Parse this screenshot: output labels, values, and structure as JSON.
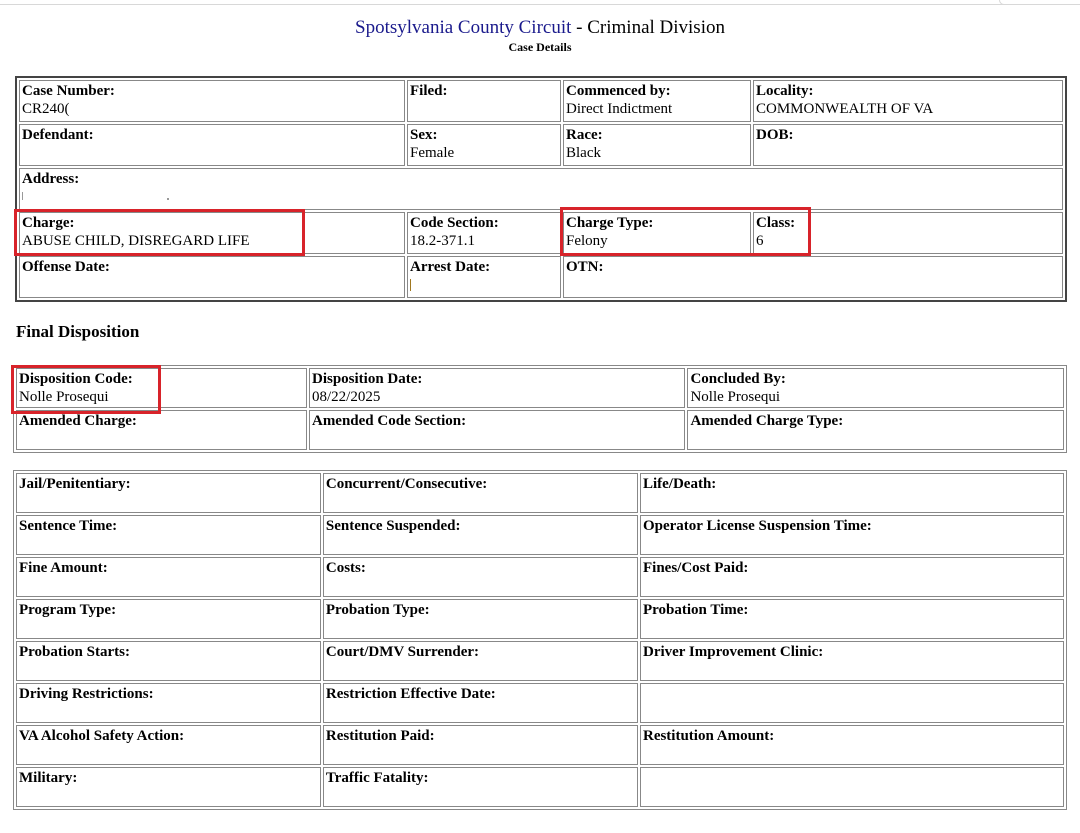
{
  "header": {
    "court_name": "Spotsylvania County Circuit",
    "division": " - Criminal Division",
    "subtitle": "Case Details"
  },
  "case": {
    "case_number_label": "Case Number:",
    "case_number": "CR240(",
    "filed_label": "Filed:",
    "filed": "",
    "commenced_label": "Commenced by:",
    "commenced": "Direct Indictment",
    "locality_label": "Locality:",
    "locality": "COMMONWEALTH OF VA",
    "defendant_label": "Defendant:",
    "defendant": "",
    "sex_label": "Sex:",
    "sex": "Female",
    "race_label": "Race:",
    "race": "Black",
    "dob_label": "DOB:",
    "dob": "",
    "address_label": "Address:",
    "charge_label": "Charge:",
    "charge": "ABUSE CHILD, DISREGARD LIFE",
    "code_section_label": "Code Section:",
    "code_section": "18.2-371.1",
    "charge_type_label": "Charge Type:",
    "charge_type": "Felony",
    "class_label": "Class:",
    "class": "6",
    "offense_date_label": "Offense Date:",
    "offense_date": "",
    "arrest_date_label": "Arrest Date:",
    "otn_label": "OTN:",
    "otn": ""
  },
  "final_disposition": {
    "title": "Final Disposition",
    "disposition_code_label": "Disposition Code:",
    "disposition_code": "Nolle Prosequi",
    "disposition_date_label": "Disposition Date:",
    "disposition_date": "08/22/2025",
    "concluded_by_label": "Concluded By:",
    "concluded_by": "Nolle Prosequi",
    "amended_charge_label": "Amended Charge:",
    "amended_code_section_label": "Amended Code Section:",
    "amended_charge_type_label": "Amended Charge Type:"
  },
  "sentencing": {
    "jail_label": "Jail/Penitentiary:",
    "concurrent_label": "Concurrent/Consecutive:",
    "life_death_label": "Life/Death:",
    "sentence_time_label": "Sentence Time:",
    "sentence_suspended_label": "Sentence Suspended:",
    "operator_license_label": "Operator License Suspension Time:",
    "fine_amount_label": "Fine Amount:",
    "costs_label": "Costs:",
    "fines_cost_paid_label": "Fines/Cost Paid:",
    "program_type_label": "Program Type:",
    "probation_type_label": "Probation Type:",
    "probation_time_label": "Probation Time:",
    "probation_starts_label": "Probation Starts:",
    "court_dmv_label": "Court/DMV Surrender:",
    "driver_improvement_label": "Driver Improvement Clinic:",
    "driving_restrictions_label": "Driving Restrictions:",
    "restriction_effective_label": "Restriction Effective Date:",
    "va_alcohol_label": "VA Alcohol Safety Action:",
    "restitution_paid_label": "Restitution Paid:",
    "restitution_amount_label": "Restitution Amount:",
    "military_label": "Military:",
    "traffic_fatality_label": "Traffic Fatality:"
  },
  "colors": {
    "highlight": "#d8232a",
    "court_link": "#1a1a8c"
  }
}
